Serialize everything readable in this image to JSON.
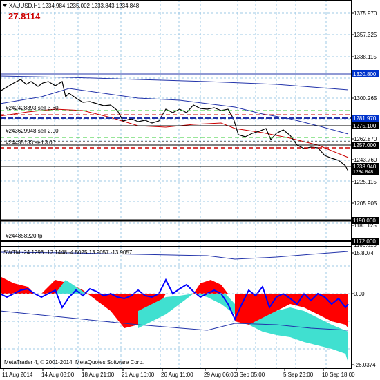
{
  "header": {
    "symbol_line": "XAUUSD,H1  1234.984 1235.002 1233.843 1234.848",
    "big_value": "27.8114"
  },
  "price_axis": {
    "ticks": [
      "1375.970",
      "1357.325",
      "1338.115",
      "1320.800",
      "1300.265",
      "1281.970",
      "1275.100",
      "1262.870",
      "1257.000",
      "1243.760",
      "1238.940",
      "1234.848",
      "1225.115",
      "1205.905",
      "1190.000",
      "1186.125",
      "1172.000",
      "1166.815"
    ],
    "current_price_label": "1234.848",
    "line_tags": [
      {
        "name": "blue-level-1320",
        "value": "1320.800",
        "bg": "#0033cc",
        "fg": "#ffffff"
      },
      {
        "name": "blue-level-1281",
        "value": "1281.970",
        "bg": "#0033cc",
        "fg": "#ffffff"
      },
      {
        "name": "black-level-1275",
        "value": "1275.100",
        "bg": "#000000",
        "fg": "#ffffff"
      },
      {
        "name": "black-level-1257",
        "value": "1257.000",
        "bg": "#000000",
        "fg": "#ffffff"
      },
      {
        "name": "black-level-1238",
        "value": "1238.940",
        "bg": "#000000",
        "fg": "#ffffff"
      },
      {
        "name": "black-level-1190",
        "value": "1190.000",
        "bg": "#000000",
        "fg": "#ffffff"
      },
      {
        "name": "black-level-1172",
        "value": "1172.000",
        "bg": "#000000",
        "fg": "#ffffff"
      }
    ]
  },
  "orders": [
    {
      "label": "#242428393 sell 3.60"
    },
    {
      "label": "#243629948 sell 2.00"
    },
    {
      "label": "#24435133 sell 3.00"
    },
    {
      "label": "#244858220 tp"
    }
  ],
  "indicator": {
    "label": "SWTM -24.1296 -12.1448 -4.5025 13.9057 -13.9057",
    "axis_ticks": [
      "15.8074",
      "0.00",
      "-26.0374"
    ]
  },
  "time_axis": {
    "labels": [
      "11 Aug 2014",
      "14 Aug 03:00",
      "18 Aug 21:00",
      "21 Aug 16:00",
      "26 Aug 11:00",
      "29 Aug 06:00",
      "3 Sep 05:00",
      "5 Sep 23:00",
      "10 Sep 18:00"
    ]
  },
  "footer": {
    "copyright": "MetaTrader 4, © 2001-2014, MetaQuotes Software Corp."
  },
  "colors": {
    "grid": "#9ec8e6",
    "price_line": "#000000",
    "blue_ma": "#2233aa",
    "red_ma": "#cc0000",
    "green_dashed": "#33cc33",
    "red_dashed": "#cc0000",
    "indicator_red": "#ff0000",
    "indicator_cyan": "#40e0d0",
    "indicator_blue": "#0000ff",
    "big_value": "#cc0000"
  }
}
